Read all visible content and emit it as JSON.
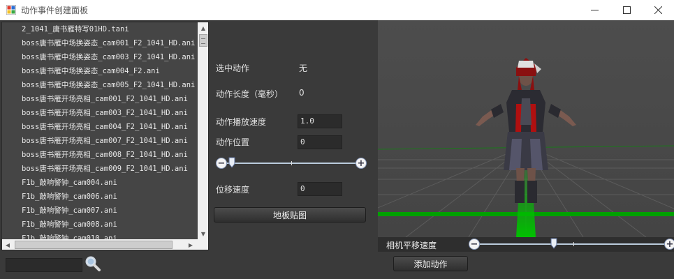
{
  "window": {
    "title": "动作事件创建面板"
  },
  "action_list": {
    "items": [
      "2_1041_唐书雁特写01HD.tani",
      "boss唐书雁中场换姿态_cam001_F2_1041_HD.ani",
      "boss唐书雁中场换姿态_cam003_F2_1041_HD.ani",
      "boss唐书雁中场换姿态_cam004_F2.ani",
      "boss唐书雁中场换姿态_cam005_F2_1041_HD.ani",
      "boss唐书雁开场亮相_cam001_F2_1041_HD.ani",
      "boss唐书雁开场亮相_cam003_F2_1041_HD.ani",
      "boss唐书雁开场亮相_cam004_F2_1041_HD.ani",
      "boss唐书雁开场亮相_cam007_F2_1041_HD.ani",
      "boss唐书雁开场亮相_cam008_F2_1041_HD.ani",
      "boss唐书雁开场亮相_cam009_F2_1041_HD.ani",
      "F1b_敲响警钟_cam004.ani",
      "F1b_敲响警钟_cam006.ani",
      "F1b_敲响警钟_cam007.ani",
      "F1b_敲响警钟_cam008.ani",
      "F1b_敲响警钟_cam010.ani"
    ]
  },
  "properties": {
    "selected_action_label": "选中动作",
    "selected_action_value": "无",
    "action_length_label": "动作长度（毫秒）",
    "action_length_value": "0",
    "play_speed_label": "动作播放速度",
    "play_speed_value": "1.0",
    "action_position_label": "动作位置",
    "action_position_value": "0",
    "move_speed_label": "位移速度",
    "move_speed_value": "0",
    "floor_texture_button": "地板贴图"
  },
  "camera": {
    "pan_speed_label": "相机平移速度"
  },
  "footer": {
    "add_action_button": "添加动作",
    "search_value": ""
  },
  "colors": {
    "panel_bg": "#3a3a3a",
    "list_bg": "#454545",
    "viewport_bg": "#4a4a4a",
    "floor_green": "#00a000"
  }
}
